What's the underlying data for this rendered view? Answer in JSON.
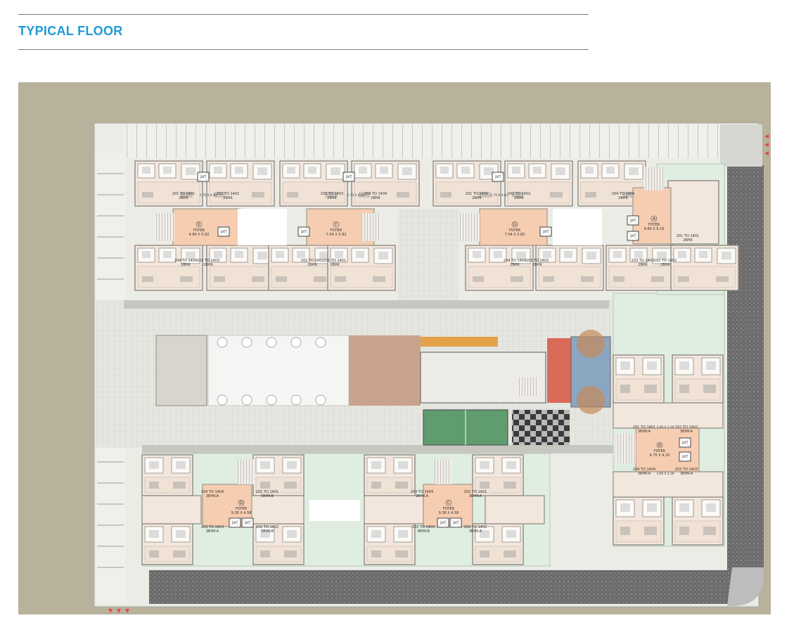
{
  "header": {
    "title": "TYPICAL FLOOR"
  },
  "colors": {
    "accent": "#1f9ad6",
    "ground": "#b8b19c",
    "paving": "#e9e9e4",
    "garden": "#dfeee0",
    "unit_floor": "#f3e6dc",
    "foyer": "#f6cdb1",
    "wall": "#8e8a83",
    "road": "#5f5f5f"
  },
  "blocks": {
    "E": {
      "letter": "E",
      "foyer": "FOYER",
      "dims": "4.89 X 5.82",
      "u1_range": "201 TO 1401",
      "u1_type": "2BHK",
      "u2_range": "202 TO 1402",
      "u2_type": "2BHK",
      "u3_range": "204 TO 1404",
      "u3_type": "2BHK",
      "u4_range": "203 TO 1403",
      "u4_type": "2BHK",
      "lift": "LIFT",
      "lobby": "2.75 X 4.41"
    },
    "F": {
      "letter": "F",
      "foyer": "FOYER",
      "dims": "7.54 X 5.82",
      "u1_range": "203 TO 1403",
      "u1_type": "2BHK",
      "u2_range": "204 TO 1404",
      "u2_type": "2BHK",
      "u3_range": "202 TO 1402",
      "u3_type": "2BHK",
      "u4_range": "201 TO 1401",
      "u4_type": "2BHK",
      "lift": "LIFT",
      "lobby": "2.75 X 4.41"
    },
    "G": {
      "letter": "G",
      "foyer": "FOYER",
      "dims": "7.54 X 5.82",
      "u1_range": "201 TO 1401",
      "u1_type": "2BHK",
      "u2_range": "202 TO 1402",
      "u2_type": "2BHK",
      "u3_range": "204 TO 1404",
      "u3_type": "2BHK",
      "u4_range": "203 TO 1403",
      "u4_type": "2BHK",
      "lift": "LIFT",
      "lobby": "2.75 X 4.41"
    },
    "A": {
      "letter": "A",
      "foyer": "FOYER",
      "dims": "4.89 X 9.16",
      "u1_range": "204 TO 1404",
      "u1_type": "2BHK",
      "u2_range": "201 TO 1401",
      "u2_type": "2BHK",
      "u3_range": "203 TO 1403",
      "u3_type": "2BHK",
      "u4_range": "202 TO 1402",
      "u4_type": "2BHK",
      "lift": "LIFT"
    },
    "B": {
      "letter": "B",
      "foyer": "FOYER",
      "dims": "4.75 X 4.20",
      "u1_range": "201 TO 1401",
      "u1_type": "3BHK-A",
      "u2_range": "202 TO 1402",
      "u2_type": "3BHK-A",
      "u3_range": "204 TO 1404",
      "u3_type": "3BHK-A",
      "u4_range": "203 TO 1403",
      "u4_type": "3BHK-A",
      "lift": "LIFT",
      "lobby_top": "3.00 X 2.19",
      "lobby_bottom": "3.00 X 2.18"
    },
    "D": {
      "letter": "D",
      "foyer": "FOYER",
      "dims": "9.38 X 4.58",
      "u1_range": "204 TO 1404",
      "u1_type": "3BHK-A",
      "u2_range": "201 TO 1401",
      "u2_type": "3BHK-B",
      "u3_range": "203 TO 1403",
      "u3_type": "3BHK-A",
      "u4_range": "202 TO 1402",
      "u4_type": "3BHK-B",
      "lift": "LIFT"
    },
    "C": {
      "letter": "C",
      "foyer": "FOYER",
      "dims": "9.38 X 4.58",
      "u1_range": "204 TO 1404",
      "u1_type": "3BHK-A",
      "u2_range": "201 TO 1401",
      "u2_type": "3BHK-A",
      "u3_range": "203 TO 1403",
      "u3_type": "3BHK-B",
      "u4_range": "202 TO 1402",
      "u4_type": "3BHK-A",
      "lift": "LIFT"
    }
  }
}
